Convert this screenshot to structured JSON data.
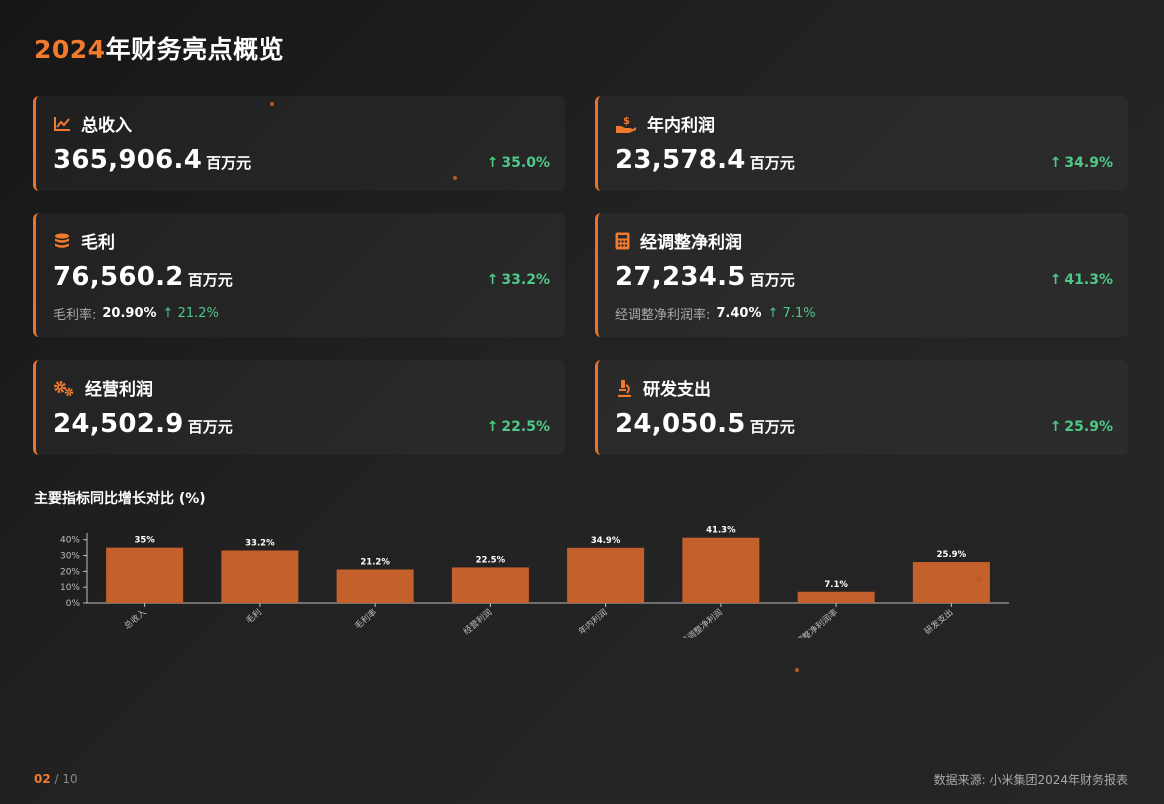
{
  "header": {
    "title_year": "2024",
    "title_rest": "年财务亮点概览"
  },
  "colors": {
    "accent": "#f07a2e",
    "bar": "#c4602b",
    "growth": "#4fc88a"
  },
  "cards": [
    {
      "icon": "line-chart-icon",
      "label": "总收入",
      "value": "365,906.4",
      "unit": "百万元",
      "growth": "35.0%"
    },
    {
      "icon": "hand-dollar-icon",
      "label": "年内利润",
      "value": "23,578.4",
      "unit": "百万元",
      "growth": "34.9%"
    },
    {
      "icon": "coins-icon",
      "label": "毛利",
      "value": "76,560.2",
      "unit": "百万元",
      "growth": "33.2%",
      "sub_label": "毛利率:",
      "sub_value": "20.90%",
      "sub_growth": "21.2%"
    },
    {
      "icon": "calculator-icon",
      "label": "经调整净利润",
      "value": "27,234.5",
      "unit": "百万元",
      "growth": "41.3%",
      "sub_label": "经调整净利润率:",
      "sub_value": "7.40%",
      "sub_growth": "7.1%"
    },
    {
      "icon": "gears-icon",
      "label": "经营利润",
      "value": "24,502.9",
      "unit": "百万元",
      "growth": "22.5%"
    },
    {
      "icon": "microscope-icon",
      "label": "研发支出",
      "value": "24,050.5",
      "unit": "百万元",
      "growth": "25.9%"
    }
  ],
  "chart_section": {
    "title": "主要指标同比增长对比 (%)"
  },
  "chart_data": {
    "type": "bar",
    "categories": [
      "总收入",
      "毛利",
      "毛利率",
      "经营利润",
      "年内利润",
      "经调整净利润",
      "经调整净利润率",
      "研发支出"
    ],
    "values": [
      35,
      33.2,
      21.2,
      22.5,
      34.9,
      41.3,
      7.1,
      25.9
    ],
    "data_labels": [
      "35%",
      "33.2%",
      "21.2%",
      "22.5%",
      "34.9%",
      "41.3%",
      "7.1%",
      "25.9%"
    ],
    "y_ticks": [
      "0%",
      "10%",
      "20%",
      "30%",
      "40%"
    ],
    "ylim": [
      0,
      43
    ],
    "grid": false,
    "xlabel": "",
    "ylabel": ""
  },
  "footer": {
    "page_current": "02",
    "page_total": "/ 10",
    "source": "数据来源: 小米集团2024年财务报表"
  }
}
